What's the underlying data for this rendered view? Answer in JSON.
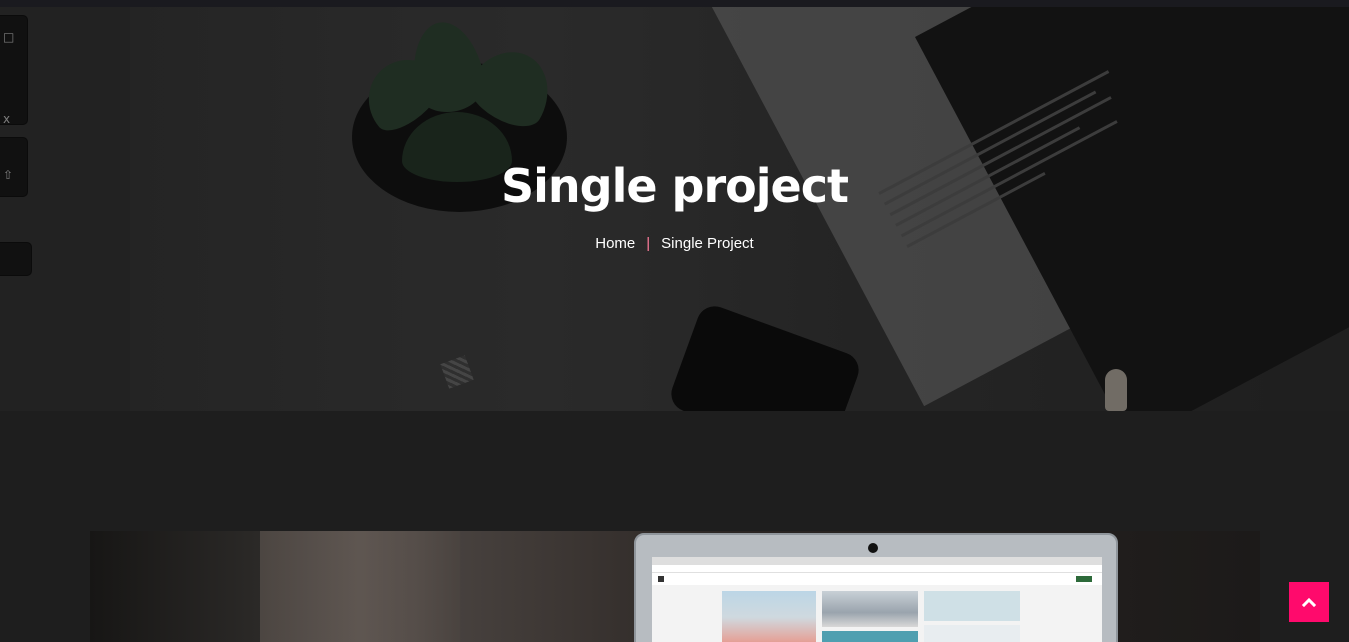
{
  "hero": {
    "title": "Single project",
    "breadcrumb": {
      "home": "Home",
      "separator": "|",
      "current": "Single Project"
    }
  },
  "icons": {
    "back_to_top": "chevron-up-icon"
  },
  "colors": {
    "background": "#1e1e1e",
    "accent": "#ff0a6c",
    "breadcrumb_separator": "#ff7c9c",
    "hero_text": "#ffffff"
  }
}
